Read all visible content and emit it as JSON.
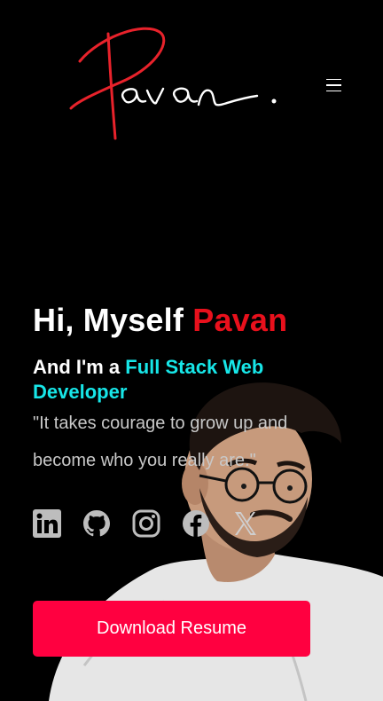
{
  "header": {
    "logo_text": "Pavan.",
    "menu_icon": "hamburger-menu-icon"
  },
  "hero": {
    "greeting_prefix": "Hi, Myself",
    "greeting_name": "Pavan",
    "role_prefix": "And I'm a",
    "role_title": "Full Stack Web Developer",
    "quote": "\"It takes courage to grow up and become who you really are.\""
  },
  "socials": [
    {
      "icon": "linkedin-icon"
    },
    {
      "icon": "github-icon"
    },
    {
      "icon": "instagram-icon"
    },
    {
      "icon": "facebook-icon"
    },
    {
      "icon": "x-twitter-icon"
    }
  ],
  "cta": {
    "label": "Download Resume"
  },
  "colors": {
    "background": "#000000",
    "name_accent": "#e8101c",
    "role_accent": "#17e6e8",
    "button": "#ff0040",
    "quote_text": "#c8c8c8",
    "icons": "#bdbdbd"
  }
}
